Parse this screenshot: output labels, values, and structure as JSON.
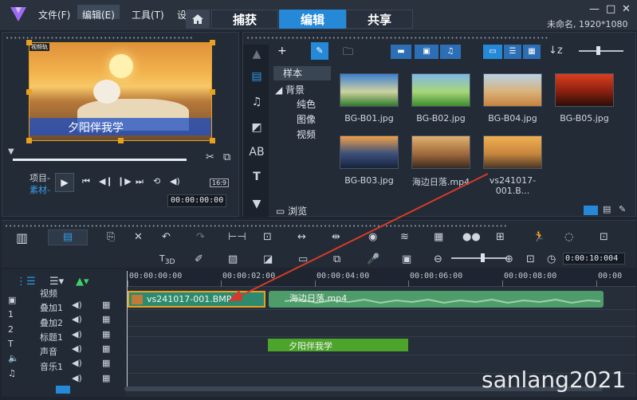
{
  "menu": {
    "file": "文件(F)",
    "edit": "编辑(E)",
    "tools": "工具(T)",
    "settings": "设"
  },
  "tabs": {
    "capture": "捕获",
    "edit": "编辑",
    "share": "共享"
  },
  "window": {
    "project_info": "未命名, 1920*1080",
    "minimize": "—",
    "maximize": "□",
    "close": "✕"
  },
  "player": {
    "caption": "夕阳伴我学",
    "preview_tag": "视频轨",
    "mode_project": "项目-",
    "mode_clip": "素材-",
    "timecode": "00:00:00:00",
    "aspect": "16:9"
  },
  "library": {
    "tree": {
      "sample": "样本",
      "background": "背景",
      "color": "纯色",
      "image": "图像",
      "video": "视频"
    },
    "browse": "浏览",
    "items": [
      {
        "label": "BG-B01.jpg",
        "colors": [
          "#3c7fd0",
          "#cfd2a0",
          "#2f7a2c"
        ]
      },
      {
        "label": "BG-B02.jpg",
        "colors": [
          "#7fb7e6",
          "#a9d67b",
          "#3e8d2e"
        ]
      },
      {
        "label": "BG-B04.jpg",
        "colors": [
          "#b8d2e6",
          "#d9b27a",
          "#c8823f"
        ]
      },
      {
        "label": "BG-B05.jpg",
        "colors": [
          "#d9401e",
          "#8a1f10",
          "#2b0e08"
        ]
      },
      {
        "label": "BG-B03.jpg",
        "colors": [
          "#f0a04a",
          "#3a4f7a",
          "#18233b"
        ]
      },
      {
        "label": "海边日落.mp4",
        "colors": [
          "#e0b070",
          "#a06a3c",
          "#3a2b22"
        ]
      },
      {
        "label": "vs241017-001.B...",
        "colors": [
          "#f0b050",
          "#c7863e",
          "#4a3826"
        ]
      }
    ]
  },
  "timeline": {
    "timecode": "0:00:10:004",
    "ruler": [
      "00:00:00:00",
      "00:00:02:00",
      "00:00:04:00",
      "00:00:06:00",
      "00:00:08:00",
      "00:00"
    ],
    "tracks": [
      "视频",
      "叠加1",
      "叠加2",
      "标题1",
      "声音",
      "音乐1"
    ],
    "clips": {
      "bmp": "vs241017-001.BMP",
      "mp4": "海边日落.mp4",
      "title": "夕阳伴我学"
    }
  },
  "watermark": "sanlang2021",
  "colors": {
    "accent": "#2589d8",
    "clip_border": "#e8a020",
    "arrow": "#d63a2a"
  }
}
